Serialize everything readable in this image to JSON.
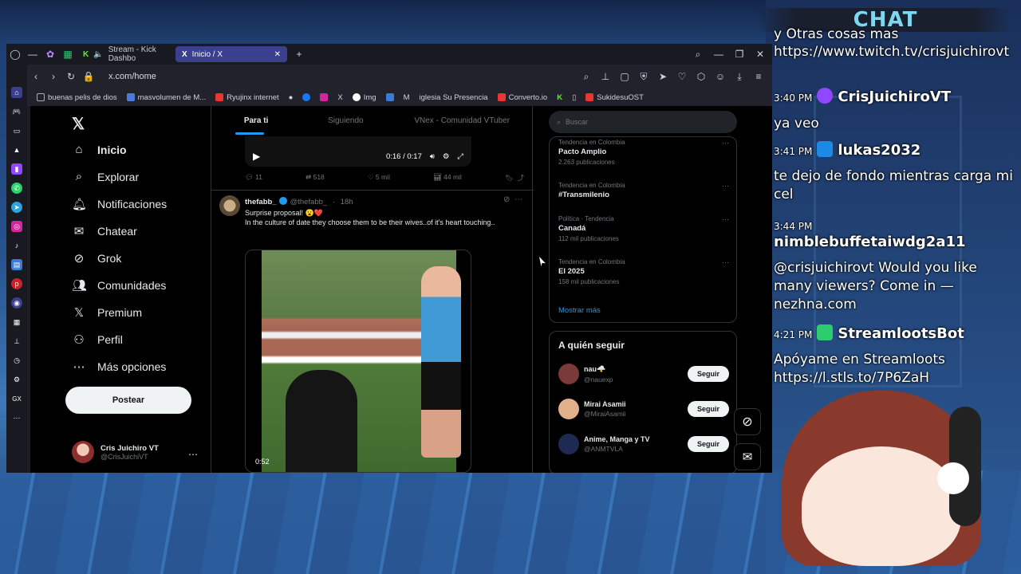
{
  "browser": {
    "tabs": [
      {
        "label": "Stream - Kick Dashbo"
      },
      {
        "label": "Inicio / X"
      }
    ],
    "url": "x.com/home",
    "bookmarks": [
      {
        "label": "buenas pelis de dios"
      },
      {
        "label": "masvolumen de M..."
      },
      {
        "label": "Ryujinx internet"
      },
      {
        "label": "Img"
      },
      {
        "label": "iglesia Su Presencia"
      },
      {
        "label": "Converto.io"
      },
      {
        "label": "SukidesuOST"
      }
    ]
  },
  "x": {
    "nav": [
      {
        "label": "Inicio",
        "icon": "home-icon"
      },
      {
        "label": "Explorar",
        "icon": "search-icon"
      },
      {
        "label": "Notificaciones",
        "icon": "bell-icon"
      },
      {
        "label": "Chatear",
        "icon": "mail-icon"
      },
      {
        "label": "Grok",
        "icon": "grok-icon"
      },
      {
        "label": "Comunidades",
        "icon": "people-icon"
      },
      {
        "label": "Premium",
        "icon": "x-icon"
      },
      {
        "label": "Perfil",
        "icon": "user-icon"
      },
      {
        "label": "Más opciones",
        "icon": "more-icon"
      }
    ],
    "post_button": "Postear",
    "profile": {
      "name": "Cris Juichiro VT",
      "handle": "@CrisJuichiVT"
    },
    "feed_tabs": [
      "Para ti",
      "Siguiendo",
      "VNex - Comunidad VTuber"
    ],
    "video1": {
      "time": "0:16 / 0:17"
    },
    "actions": {
      "replies": "11",
      "reposts": "518",
      "likes": "5 mil",
      "views": "44 mil"
    },
    "tweet": {
      "name": "thefabb_",
      "handle": "@thefabb_",
      "age": "18h",
      "line1": "Surprise proposal! 😮❤️",
      "line2": "In the culture of date they choose them to be their wives..of it's heart touching..",
      "video_time": "0:52"
    },
    "search_placeholder": "Buscar",
    "trends": [
      {
        "context": "Tendencia en Colombia",
        "title": "Pacto Amplio",
        "posts": "2.263 publicaciones"
      },
      {
        "context": "Tendencia en Colombia",
        "title": "#Transmilenio",
        "posts": ""
      },
      {
        "context": "Política · Tendencia",
        "title": "Canadá",
        "posts": "112 mil publicaciones"
      },
      {
        "context": "Tendencia en Colombia",
        "title": "El 2025",
        "posts": "158 mil publicaciones"
      }
    ],
    "show_more": "Mostrar más",
    "who_to_follow_title": "A quién seguir",
    "who_to_follow": [
      {
        "name": "nau🌩️",
        "handle": "@nauexp",
        "button": "Seguir"
      },
      {
        "name": "Mirai Asamii",
        "handle": "@MiraiAsamii",
        "button": "Seguir"
      },
      {
        "name": "Anime, Manga y TV",
        "handle": "@ANMTVLA",
        "button": "Seguir"
      }
    ]
  },
  "chat": {
    "title": "CHAT",
    "lines": [
      {
        "text": "y Otras cosas mas"
      },
      {
        "text": "https://www.twitch.tv/crisjuichirovt"
      },
      {
        "time": "3:40 PM",
        "user": "CrisJuichiroVT"
      },
      {
        "text": "ya veo"
      },
      {
        "time": "3:41 PM",
        "user": "lukas2032"
      },
      {
        "text": "te dejo de fondo mientras carga mi cel"
      },
      {
        "time": "3:44 PM",
        "user": "nimblebuffetaiwdg2a11"
      },
      {
        "text": "@crisjuichirovt Would you like many viewers? Come in — nezhna.com"
      },
      {
        "time": "4:21 PM",
        "user": "StreamlootsBot"
      },
      {
        "text": "Apóyame en Streamloots https://l.stls.to/7P6ZaH"
      }
    ]
  },
  "colors": {
    "accent": "#1d9bf0",
    "chat_title": "#7fd6f0",
    "tab_active": "#3a3f8e"
  }
}
